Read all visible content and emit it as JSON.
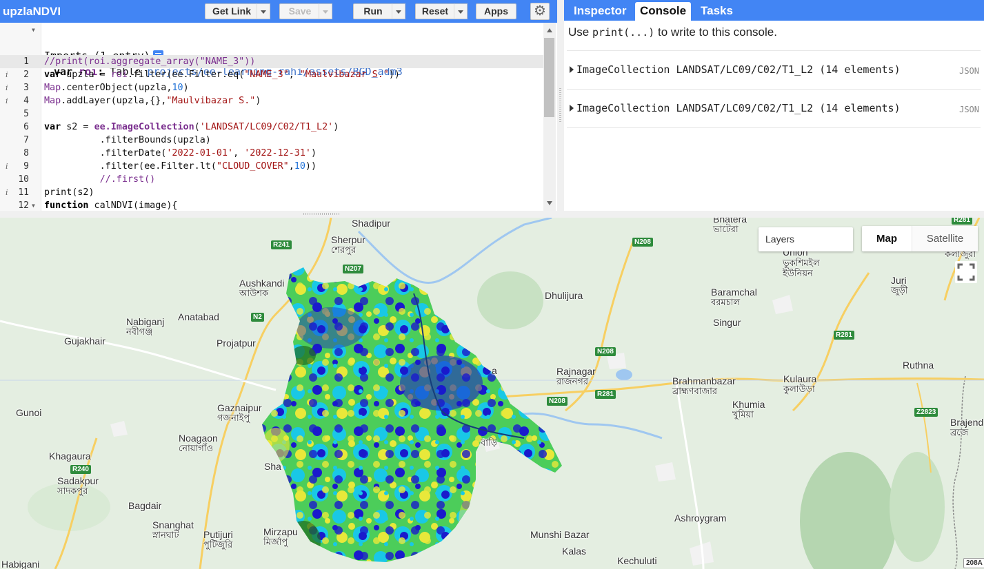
{
  "editor": {
    "script_title": "upzlaNDVI",
    "toolbar": {
      "get_link": "Get Link",
      "save": "Save",
      "run": "Run",
      "reset": "Reset",
      "apps": "Apps"
    },
    "imports_label": "Imports (1 entry)",
    "import_line": {
      "kw": "var",
      "name": "roi",
      "type": "Table",
      "path": "projects/ee-learning-rahi/assets/BGD_adm3"
    },
    "lines": [
      {
        "n": "1",
        "code": "//print(roi.aggregate_array(\"NAME_3\"))"
      },
      {
        "n": "2",
        "code": "var upzla = roi.filter(ee.Filter.eq(\"NAME_3\", \"Maulvibazar S.\"))"
      },
      {
        "n": "3",
        "code": "Map.centerObject(upzla,10)"
      },
      {
        "n": "4",
        "code": "Map.addLayer(upzla,{},\"Maulvibazar S.\")"
      },
      {
        "n": "5",
        "code": ""
      },
      {
        "n": "6",
        "code": "var s2 = ee.ImageCollection('LANDSAT/LC09/C02/T1_L2')"
      },
      {
        "n": "7",
        "code": "          .filterBounds(upzla)"
      },
      {
        "n": "8",
        "code": "          .filterDate('2022-01-01', '2022-12-31')"
      },
      {
        "n": "9",
        "code": "          .filter(ee.Filter.lt(\"CLOUD_COVER\",10))"
      },
      {
        "n": "10",
        "code": "          //.first()"
      },
      {
        "n": "11",
        "code": "print(s2)"
      },
      {
        "n": "12",
        "code": "function calNDVI(image){"
      }
    ]
  },
  "console_panel": {
    "tabs": [
      "Inspector",
      "Console",
      "Tasks"
    ],
    "active_tab": "Console",
    "hint_prefix": "Use",
    "hint_code": "print(...)",
    "hint_suffix": "to write to this console.",
    "entries": [
      {
        "text": "ImageCollection LANDSAT/LC09/C02/T1_L2 (14 elements)",
        "tag": "JSON"
      },
      {
        "text": "ImageCollection LANDSAT/LC09/C02/T1_L2 (14 elements)",
        "tag": "JSON"
      }
    ]
  },
  "map": {
    "layers_label": "Layers",
    "map_type_map": "Map",
    "map_type_satellite": "Satellite",
    "places": [
      {
        "en": "Shadipur"
      },
      {
        "en": "Sherpur",
        "bn": "শেরপুর"
      },
      {
        "en": "Aushkandi",
        "bn": "আউশক"
      },
      {
        "en": "Nabiganj",
        "bn": "নবীগঞ্জ"
      },
      {
        "en": "Anatabad"
      },
      {
        "en": "Gujakhair"
      },
      {
        "en": "Projatpur"
      },
      {
        "en": "Gaznaipur",
        "bn": "গজনাইপু"
      },
      {
        "en": "Gunoi"
      },
      {
        "en": "Noagaon",
        "bn": "নোয়াগাঁও"
      },
      {
        "en": "Khagaura"
      },
      {
        "en": "Sadakpur",
        "bn": "সাদকপুর"
      },
      {
        "en": "Bagdair"
      },
      {
        "en": "Snanghat",
        "bn": "স্নানঘাট"
      },
      {
        "en": "Putijuri",
        "bn": "পুটিজুরি"
      },
      {
        "en": "Mirzapu",
        "bn": "মির্জাপু"
      },
      {
        "en": "Habigani"
      },
      {
        "en": "Dhulijura"
      },
      {
        "en": "Rajnagar",
        "bn": "রাজনগর"
      },
      {
        "en": "Bhatera",
        "bn": "ভাটেরা"
      },
      {
        "en": "Union",
        "bn": "ভুকশিমইল ইউনিয়ন"
      },
      {
        "en": "Baramchal",
        "bn": "বরমচাল"
      },
      {
        "en": "Singur"
      },
      {
        "en": "Juri",
        "bn": "জুড়ী"
      },
      {
        "en": "Brahmanbazar",
        "bn": "ব্রাহ্মণবাজার"
      },
      {
        "en": "Kulaura",
        "bn": "কুলাউড়া"
      },
      {
        "en": "Khumia",
        "bn": "খুমিয়া"
      },
      {
        "en": "Ruthna"
      },
      {
        "en": "Brajend",
        "bn": "ব্রজে"
      },
      {
        "en": "Ashroygram"
      },
      {
        "en": "Munshi Bazar"
      },
      {
        "en": "Kalas"
      },
      {
        "en": "Kechuluti"
      },
      {
        "en": "Sha"
      },
      {
        "en": "a"
      },
      {
        "en": "বাড়ি"
      },
      {
        "en": "কলাজুরা"
      }
    ],
    "shields": [
      "R241",
      "N207",
      "N2",
      "R240",
      "N208",
      "N208",
      "N208",
      "R281",
      "R281",
      "Z2823",
      "R281",
      "208A"
    ]
  },
  "colors": {
    "toolbar_blue": "#4285f4",
    "ndvi_dark_blue": "#1a1acc",
    "ndvi_cyan": "#19c8e6",
    "ndvi_green": "#4ccd5a",
    "ndvi_yellow": "#e8e83a",
    "ndvi_dark_green": "#1f6b1f"
  }
}
